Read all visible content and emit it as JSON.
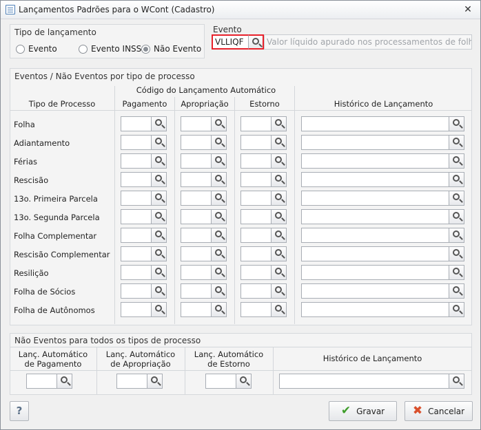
{
  "window": {
    "title": "Lançamentos Padrões para o WCont (Cadastro)",
    "close_glyph": "✕"
  },
  "tipo": {
    "title": "Tipo de lançamento",
    "options": [
      {
        "label": "Evento",
        "checked": false
      },
      {
        "label": "Evento INSS",
        "checked": false
      },
      {
        "label": "Não Evento",
        "checked": true
      }
    ]
  },
  "evento": {
    "label": "Evento",
    "code": "VLLIQF",
    "description": "Valor líquido apurado nos processamentos de folha, féria"
  },
  "grid": {
    "title": "Eventos / Não Eventos por tipo de processo",
    "group_header": "Código do Lançamento Automático",
    "headers": {
      "tipo": "Tipo de Processo",
      "pagamento": "Pagamento",
      "apropriacao": "Apropriação",
      "estorno": "Estorno",
      "historico": "Histórico de Lançamento"
    },
    "rows": [
      "Folha",
      "Adiantamento",
      "Férias",
      "Rescisão",
      "13o. Primeira Parcela",
      "13o. Segunda Parcela",
      "Folha Complementar",
      "Rescisão Complementar",
      "Resilição",
      "Folha de Sócios",
      "Folha de Autônomos"
    ]
  },
  "naoeventos": {
    "title": "Não Eventos para todos os tipos de processo",
    "headers": {
      "pagamento_1": "Lanç. Automático",
      "pagamento_2": "de Pagamento",
      "apropriacao_1": "Lanç. Automático",
      "apropriacao_2": "de Apropriação",
      "estorno_1": "Lanç. Automático",
      "estorno_2": "de Estorno",
      "historico": "Histórico de Lançamento"
    }
  },
  "buttons": {
    "help": "?",
    "save": "Gravar",
    "cancel": "Cancelar"
  },
  "icons": {
    "search": "search-icon",
    "check": "check-icon",
    "cancel": "x-icon",
    "help": "help-icon"
  },
  "colors": {
    "highlight": "#e8202a",
    "check": "#3e9d2a",
    "cancel": "#d9502c"
  }
}
